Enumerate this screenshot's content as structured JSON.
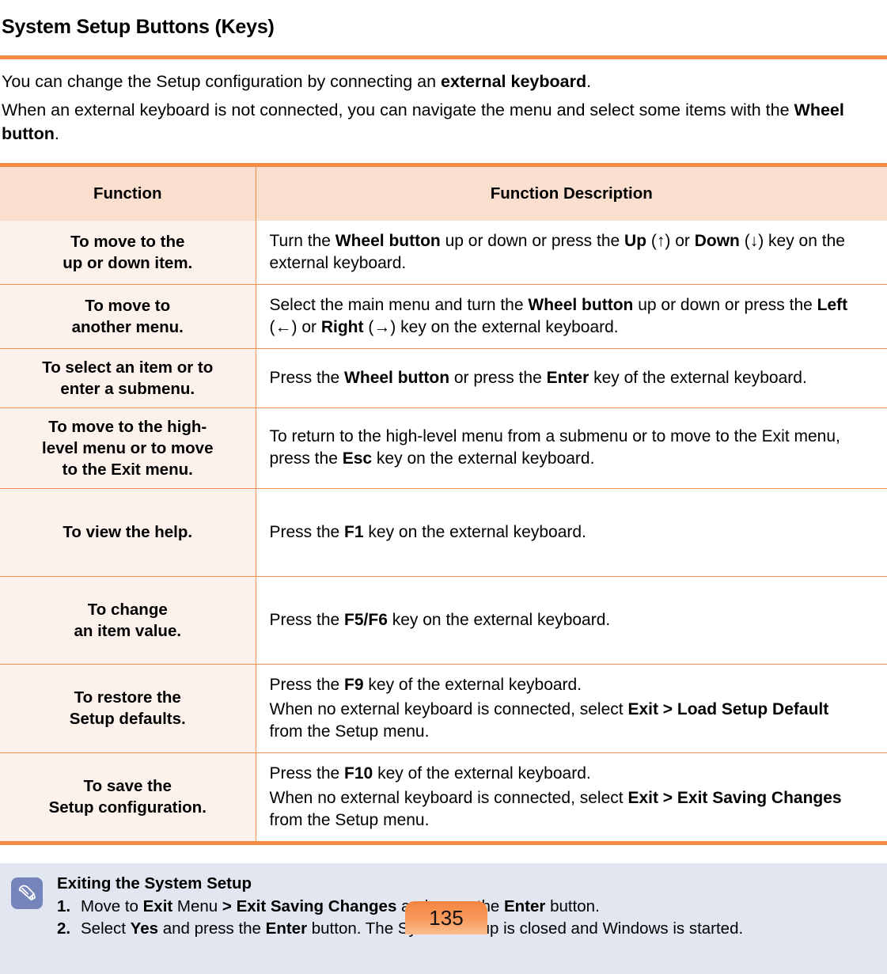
{
  "document": {
    "title": "System Setup Buttons (Keys)",
    "intro": [
      {
        "id": "intro-line-1",
        "segments": [
          {
            "t": "You can change the Setup configuration by connecting an ",
            "b": false
          },
          {
            "t": "external keyboard",
            "b": true
          },
          {
            "t": ".",
            "b": false
          }
        ]
      },
      {
        "id": "intro-line-2",
        "segments": [
          {
            "t": "When an external keyboard is not connected, you can navigate the menu and select some items with the ",
            "b": false
          },
          {
            "t": "Wheel button",
            "b": true
          },
          {
            "t": ".",
            "b": false
          }
        ]
      }
    ],
    "table": {
      "headers": [
        "Function",
        "Function Description"
      ],
      "rows": [
        {
          "function": "To move to the\nup or down item.",
          "description_lines": [
            [
              {
                "t": "Turn the ",
                "b": false
              },
              {
                "t": "Wheel button",
                "b": true
              },
              {
                "t": " up or down or press the ",
                "b": false
              },
              {
                "t": "Up",
                "b": true
              },
              {
                "t": " (↑) or ",
                "b": false
              },
              {
                "t": "Down",
                "b": true
              },
              {
                "t": " (↓) key on the external keyboard.",
                "b": false
              }
            ]
          ]
        },
        {
          "function": "To move to\nanother menu.",
          "description_lines": [
            [
              {
                "t": "Select the main menu and turn the ",
                "b": false
              },
              {
                "t": "Wheel button",
                "b": true
              },
              {
                "t": " up or down or press the ",
                "b": false
              },
              {
                "t": "Left",
                "b": true
              },
              {
                "t": " (←) or ",
                "b": false
              },
              {
                "t": "Right",
                "b": true
              },
              {
                "t": " (→) key on the external keyboard.",
                "b": false
              }
            ]
          ]
        },
        {
          "function": "To select an item or to\nenter a submenu.",
          "description_lines": [
            [
              {
                "t": "Press the ",
                "b": false
              },
              {
                "t": "Wheel button",
                "b": true
              },
              {
                "t": " or press the ",
                "b": false
              },
              {
                "t": "Enter",
                "b": true
              },
              {
                "t": " key of the external keyboard.",
                "b": false
              }
            ]
          ]
        },
        {
          "function": "To move to the high-\nlevel menu or to move\nto the Exit menu.",
          "description_lines": [
            [
              {
                "t": "To return to the high-level menu from a submenu or to move to the Exit menu, press the ",
                "b": false
              },
              {
                "t": "Esc",
                "b": true
              },
              {
                "t": " key on the external keyboard.",
                "b": false
              }
            ]
          ]
        },
        {
          "function": "To view the help.",
          "tall": true,
          "description_lines": [
            [
              {
                "t": "Press the ",
                "b": false
              },
              {
                "t": "F1",
                "b": true
              },
              {
                "t": " key on the external keyboard.",
                "b": false
              }
            ]
          ]
        },
        {
          "function": "To change\nan item value.",
          "tall": true,
          "description_lines": [
            [
              {
                "t": "Press the ",
                "b": false
              },
              {
                "t": "F5/F6",
                "b": true
              },
              {
                "t": " key on the external keyboard.",
                "b": false
              }
            ]
          ]
        },
        {
          "function": "To restore the\nSetup defaults.",
          "description_lines": [
            [
              {
                "t": "Press the ",
                "b": false
              },
              {
                "t": "F9",
                "b": true
              },
              {
                "t": " key of the external keyboard.",
                "b": false
              }
            ],
            [
              {
                "t": "When no external keyboard is connected, select ",
                "b": false
              },
              {
                "t": "Exit > Load Setup Default",
                "b": true
              },
              {
                "t": " from the Setup menu.",
                "b": false
              }
            ]
          ]
        },
        {
          "function": "To save the\nSetup configuration.",
          "description_lines": [
            [
              {
                "t": "Press the ",
                "b": false
              },
              {
                "t": "F10",
                "b": true
              },
              {
                "t": " key of the external keyboard.",
                "b": false
              }
            ],
            [
              {
                "t": "When no external keyboard is connected, select ",
                "b": false
              },
              {
                "t": "Exit > Exit Saving Changes",
                "b": true
              },
              {
                "t": " from the Setup menu.",
                "b": false
              }
            ]
          ]
        }
      ]
    },
    "note": {
      "icon": "pencil-note-icon",
      "title": "Exiting the System Setup",
      "items": [
        {
          "number": "1.",
          "segments": [
            {
              "t": "Move to ",
              "b": false
            },
            {
              "t": "Exit",
              "b": true
            },
            {
              "t": " Menu ",
              "b": false
            },
            {
              "t": "> Exit Saving Changes",
              "b": true
            },
            {
              "t": " and press the ",
              "b": false
            },
            {
              "t": "Enter",
              "b": true
            },
            {
              "t": " button.",
              "b": false
            }
          ]
        },
        {
          "number": "2.",
          "segments": [
            {
              "t": "Select ",
              "b": false
            },
            {
              "t": "Yes",
              "b": true
            },
            {
              "t": " and press the ",
              "b": false
            },
            {
              "t": "Enter",
              "b": true
            },
            {
              "t": " button. The System Setup is closed and Windows is started.",
              "b": false
            }
          ]
        }
      ]
    },
    "page_number": "135",
    "colors": {
      "accent_rule": "#F78B44",
      "table_border": "#F0914F",
      "header_fill": "#FBDFCE",
      "function_col_fill": "#FDF1EB",
      "note_fill": "#E2E6F1",
      "note_icon_fill": "#7585BC",
      "page_badge_top": "#F4853F",
      "page_badge_bottom": "#FBBE90"
    }
  }
}
